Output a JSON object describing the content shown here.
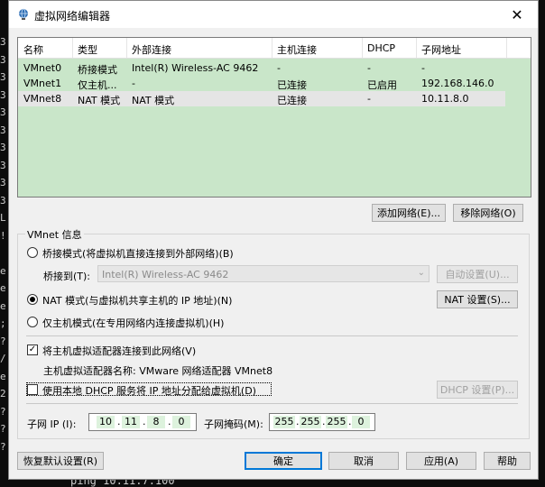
{
  "terminal": {
    "left_chars": [
      "3",
      "3",
      "3",
      "3",
      "3",
      "3",
      "3",
      "3",
      "3",
      "3",
      "L",
      "!",
      "",
      "e",
      "e",
      "e",
      ";",
      "?",
      "/",
      "e",
      "2",
      "?",
      "?",
      "?"
    ],
    "bottom_text": "ping 10.11.7.100"
  },
  "dialog": {
    "title": "虚拟网络编辑器",
    "close_glyph": "✕"
  },
  "table": {
    "headers": [
      "名称",
      "类型",
      "外部连接",
      "主机连接",
      "DHCP",
      "子网地址"
    ],
    "rows": [
      {
        "name": "VMnet0",
        "type": "桥接模式",
        "external": "Intel(R) Wireless-AC 9462",
        "host": "-",
        "dhcp": "-",
        "subnet": "-"
      },
      {
        "name": "VMnet1",
        "type": "仅主机...",
        "external": "-",
        "host": "已连接",
        "dhcp": "已启用",
        "subnet": "192.168.146.0"
      },
      {
        "name": "VMnet8",
        "type": "NAT 模式",
        "external": "NAT 模式",
        "host": "已连接",
        "dhcp": "-",
        "subnet": "10.11.8.0"
      }
    ]
  },
  "buttons": {
    "add_network": "添加网络(E)...",
    "remove_network": "移除网络(O)",
    "auto_settings": "自动设置(U)...",
    "nat_settings": "NAT 设置(S)...",
    "dhcp_settings": "DHCP 设置(P)...",
    "restore_defaults": "恢复默认设置(R)",
    "ok": "确定",
    "cancel": "取消",
    "apply": "应用(A)",
    "help": "帮助"
  },
  "vmnet_info": {
    "group_title": "VMnet 信息",
    "bridged_label": "桥接模式(将虚拟机直接连接到外部网络)(B)",
    "bridged_to_label": "桥接到(T):",
    "bridged_to_value": "Intel(R) Wireless-AC 9462",
    "nat_label": "NAT 模式(与虚拟机共享主机的 IP 地址)(N)",
    "hostonly_label": "仅主机模式(在专用网络内连接虚拟机)(H)",
    "connect_adapter_label": "将主机虚拟适配器连接到此网络(V)",
    "adapter_name_label": "主机虚拟适配器名称: VMware 网络适配器 VMnet8",
    "use_dhcp_label": "使用本地 DHCP 服务将 IP 地址分配给虚拟机(D)",
    "subnet_ip_label": "子网 IP (I):",
    "subnet_ip": [
      "10",
      "11",
      "8",
      "0"
    ],
    "subnet_mask_label": "子网掩码(M):",
    "subnet_mask": [
      "255",
      "255",
      "255",
      "0"
    ],
    "selected_mode": "nat",
    "connect_adapter_checked": true,
    "use_dhcp_checked": false
  },
  "colors": {
    "list_bg": "#c9e6c9",
    "ip_segment_bg": "#ddf2dd",
    "default_button_border": "#0078d7"
  }
}
